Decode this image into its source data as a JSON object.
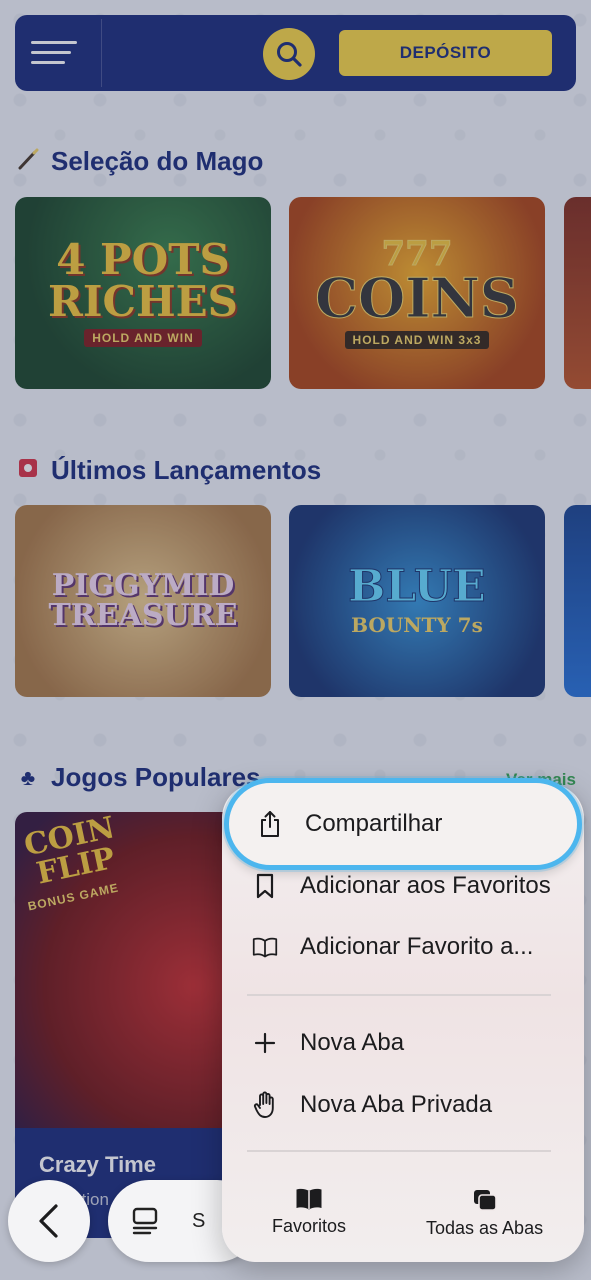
{
  "header": {
    "deposit_label": "DEPÓSITO"
  },
  "sections": [
    {
      "title": "Seleção do Mago",
      "icon": "magic-wand-icon"
    },
    {
      "title": "Últimos Lançamentos",
      "icon": "siren-icon"
    },
    {
      "title": "Jogos Populares",
      "icon": "club-suit-icon",
      "see_all": "Ver mais"
    }
  ],
  "games": {
    "g1": {
      "title_line1": "4 POTS",
      "title_line2": "RICHES",
      "sub": "HOLD AND WIN"
    },
    "g2": {
      "title_line1": "777",
      "title_line2": "COINS",
      "sub": "HOLD AND WIN 3x3"
    },
    "g3": {
      "title_line1": "PIGGYMID",
      "title_line2": "TREASURE"
    },
    "g4": {
      "title_line1": "BLUE",
      "title_line2": "BOUNTY 7s"
    },
    "g5": {
      "title_line1": "COIN",
      "title_line2": "FLIP",
      "sub": "BONUS GAME",
      "name": "Crazy Time",
      "caption": "Evolution"
    }
  },
  "browser": {
    "tab_text": "S"
  },
  "context_menu": {
    "items": [
      {
        "label": "Compartilhar",
        "icon": "share-icon",
        "highlighted": true
      },
      {
        "label": "Adicionar aos Favoritos",
        "icon": "bookmark-icon"
      },
      {
        "label": "Adicionar Favorito a...",
        "icon": "book-open-icon"
      },
      {
        "label": "Nova Aba",
        "icon": "plus-icon"
      },
      {
        "label": "Nova Aba Privada",
        "icon": "hand-icon"
      }
    ],
    "bottom": [
      {
        "label": "Favoritos",
        "icon": "book-icon"
      },
      {
        "label": "Todas as Abas",
        "icon": "tabs-icon"
      }
    ]
  },
  "colors": {
    "brand_navy": "#0d1f73",
    "brand_yellow": "#f6d33a",
    "see_all_green": "#2ca44b",
    "highlight_blue": "#4cb6ee"
  }
}
